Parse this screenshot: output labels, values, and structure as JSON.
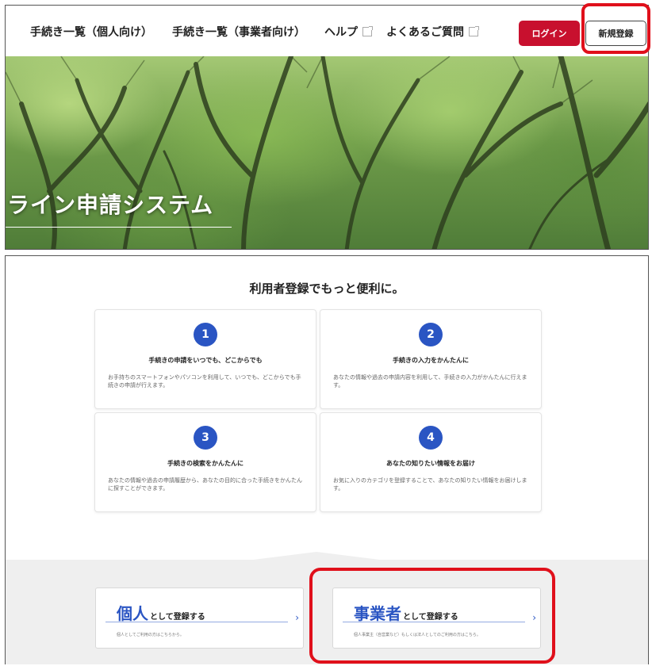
{
  "nav": {
    "links": [
      {
        "label": "手続き一覧（個人向け）"
      },
      {
        "label": "手続き一覧（事業者向け）"
      },
      {
        "label": "ヘルプ"
      },
      {
        "label": "よくあるご質問"
      }
    ],
    "login_label": "ログイン",
    "register_label": "新規登録"
  },
  "hero": {
    "title": "ライン申請システム"
  },
  "section": {
    "title": "利用者登録でもっと便利に。"
  },
  "features": [
    {
      "number": "1",
      "title": "手続きの申請をいつでも、どこからでも",
      "desc": "お手持ちのスマートフォンやパソコンを利用して、いつでも、どこからでも手続きの申請が行えます。"
    },
    {
      "number": "2",
      "title": "手続きの入力をかんたんに",
      "desc": "あなたの情報や過去の申請内容を利用して、手続きの入力がかんたんに行えます。"
    },
    {
      "number": "3",
      "title": "手続きの検索をかんたんに",
      "desc": "あなたの情報や過去の申請履歴から、あなたの目的に合った手続きをかんたんに探すことができます。"
    },
    {
      "number": "4",
      "title": "あなたの知りたい情報をお届け",
      "desc": "お気に入りのカテゴリを登録することで、あなたの知りたい情報をお届けします。"
    }
  ],
  "register": {
    "individual": {
      "main": "個人",
      "suffix": "として登録する",
      "sub": "個人としてご利用の方はこちらから。"
    },
    "business": {
      "main": "事業者",
      "suffix": "として登録する",
      "sub": "個人事業主（自営業など）もしくは法人としてのご利用の方はこちら。"
    }
  },
  "colors": {
    "accent_blue": "#2a55c3",
    "login_red": "#c8102e",
    "highlight_red": "#e0101b"
  }
}
